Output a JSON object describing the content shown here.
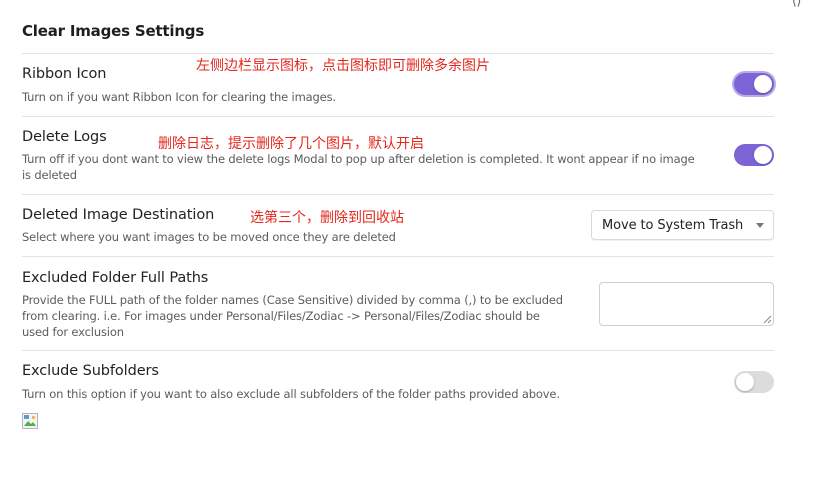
{
  "header": {
    "title": "Clear Images Settings"
  },
  "settings": [
    {
      "name": "Ribbon Icon",
      "description": "Turn on if you want Ribbon Icon for clearing the images.",
      "annotation": "左侧边栏显示图标，点击图标即可删除多余图片",
      "control": "toggle",
      "enabled": true
    },
    {
      "name": "Delete Logs",
      "description_line1": "Turn off if you dont want to view the delete logs Modal to pop up after deletion is completed. It wont appear if no image",
      "description_line2": "is deleted",
      "annotation": "删除日志，提示删除了几个图片，默认开启",
      "control": "toggle",
      "enabled": true
    },
    {
      "name": "Deleted Image Destination",
      "description": "Select where you want images to be moved once they are deleted",
      "annotation": "选第三个，删除到回收站",
      "control": "dropdown",
      "selected": "Move to System Trash"
    },
    {
      "name": "Excluded Folder Full Paths",
      "description_line1": "Provide the FULL path of the folder names (Case Sensitive) divided by comma (,) to be excluded",
      "description_line2": "from clearing. i.e. For images under Personal/Files/Zodiac -> Personal/Files/Zodiac should be",
      "description_line3": "used for exclusion",
      "control": "textarea",
      "value": ""
    },
    {
      "name": "Exclude Subfolders",
      "description": "Turn on this option if you want to also exclude all subfolders of the folder paths provided above.",
      "control": "toggle",
      "enabled": false
    }
  ],
  "colors": {
    "accent": "#7d64d6",
    "annotation": "#e5281e",
    "toggle_off": "#dcdcdc"
  }
}
